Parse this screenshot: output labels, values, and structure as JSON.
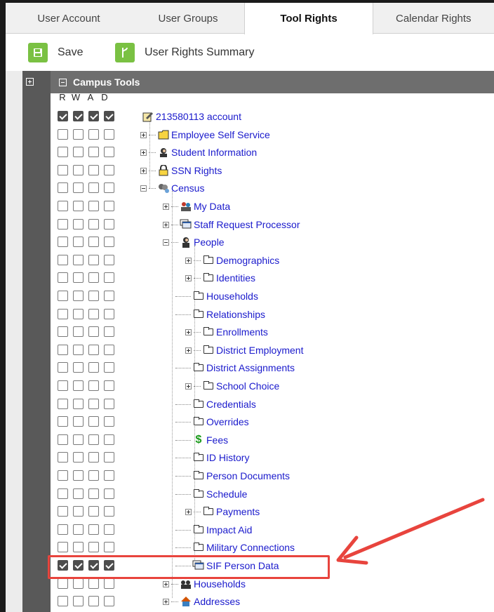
{
  "tabs": [
    {
      "label": "User Account",
      "active": false
    },
    {
      "label": "User Groups",
      "active": false
    },
    {
      "label": "Tool Rights",
      "active": true
    },
    {
      "label": "Calendar Rights",
      "active": false
    }
  ],
  "toolbar": {
    "save_label": "Save",
    "summary_label": "User Rights Summary"
  },
  "tree": {
    "header": "Campus Tools",
    "columns": [
      "R",
      "W",
      "A",
      "D"
    ],
    "rows": [
      {
        "label": "213580113 account",
        "checked": [
          true,
          true,
          true,
          true
        ],
        "icon": "edit-doc-icon"
      },
      {
        "label": "Employee Self Service",
        "checked": [
          false,
          false,
          false,
          false
        ],
        "icon": "folder-yellow-icon"
      },
      {
        "label": "Student Information",
        "checked": [
          false,
          false,
          false,
          false
        ],
        "icon": "student-icon"
      },
      {
        "label": "SSN Rights",
        "checked": [
          false,
          false,
          false,
          false
        ],
        "icon": "lock-icon"
      },
      {
        "label": "Census",
        "checked": [
          false,
          false,
          false,
          false
        ],
        "icon": "census-icon"
      },
      {
        "label": "My Data",
        "checked": [
          false,
          false,
          false,
          false
        ],
        "icon": "people-icon"
      },
      {
        "label": "Staff Request Processor",
        "checked": [
          false,
          false,
          false,
          false
        ],
        "icon": "window-stack-icon"
      },
      {
        "label": "People",
        "checked": [
          false,
          false,
          false,
          false
        ],
        "icon": "person-icon"
      },
      {
        "label": "Demographics",
        "checked": [
          false,
          false,
          false,
          false
        ],
        "icon": "folder-icon"
      },
      {
        "label": "Identities",
        "checked": [
          false,
          false,
          false,
          false
        ],
        "icon": "folder-icon"
      },
      {
        "label": "Households",
        "checked": [
          false,
          false,
          false,
          false
        ],
        "icon": "folder-icon"
      },
      {
        "label": "Relationships",
        "checked": [
          false,
          false,
          false,
          false
        ],
        "icon": "folder-icon"
      },
      {
        "label": "Enrollments",
        "checked": [
          false,
          false,
          false,
          false
        ],
        "icon": "folder-icon"
      },
      {
        "label": "District Employment",
        "checked": [
          false,
          false,
          false,
          false
        ],
        "icon": "folder-icon"
      },
      {
        "label": "District Assignments",
        "checked": [
          false,
          false,
          false,
          false
        ],
        "icon": "folder-icon"
      },
      {
        "label": "School Choice",
        "checked": [
          false,
          false,
          false,
          false
        ],
        "icon": "folder-icon"
      },
      {
        "label": "Credentials",
        "checked": [
          false,
          false,
          false,
          false
        ],
        "icon": "folder-icon"
      },
      {
        "label": "Overrides",
        "checked": [
          false,
          false,
          false,
          false
        ],
        "icon": "folder-icon"
      },
      {
        "label": "Fees",
        "checked": [
          false,
          false,
          false,
          false
        ],
        "icon": "dollar-icon"
      },
      {
        "label": "ID History",
        "checked": [
          false,
          false,
          false,
          false
        ],
        "icon": "folder-icon"
      },
      {
        "label": "Person Documents",
        "checked": [
          false,
          false,
          false,
          false
        ],
        "icon": "folder-icon"
      },
      {
        "label": "Schedule",
        "checked": [
          false,
          false,
          false,
          false
        ],
        "icon": "folder-icon"
      },
      {
        "label": "Payments",
        "checked": [
          false,
          false,
          false,
          false
        ],
        "icon": "folder-icon"
      },
      {
        "label": "Impact Aid",
        "checked": [
          false,
          false,
          false,
          false
        ],
        "icon": "folder-icon"
      },
      {
        "label": "Military Connections",
        "checked": [
          false,
          false,
          false,
          false
        ],
        "icon": "folder-icon"
      },
      {
        "label": "SIF Person Data",
        "checked": [
          true,
          true,
          true,
          true
        ],
        "icon": "window-stack-icon"
      },
      {
        "label": "Households",
        "checked": [
          false,
          false,
          false,
          false
        ],
        "icon": "household-icon"
      },
      {
        "label": "Addresses",
        "checked": [
          false,
          false,
          false,
          false
        ],
        "icon": "house-icon"
      }
    ]
  },
  "colors": {
    "link": "#1a1acc",
    "accent_green": "#7ac143",
    "highlight_red": "#e8443d",
    "header_gray": "#6e6e6e"
  }
}
